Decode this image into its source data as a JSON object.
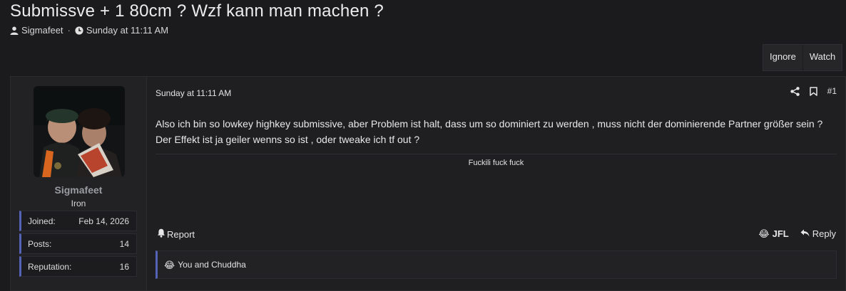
{
  "thread": {
    "title": "Submissve + 1 80cm ? Wzf kann man machen ?",
    "author": "Sigmafeet",
    "separator": "·",
    "date": "Sunday at 11:11 AM"
  },
  "header_buttons": {
    "ignore": "Ignore",
    "watch": "Watch"
  },
  "post": {
    "user": {
      "name": "Sigmafeet",
      "title": "Iron",
      "stats": [
        {
          "label": "Joined:",
          "value": "Feb 14, 2026"
        },
        {
          "label": "Posts:",
          "value": "14"
        },
        {
          "label": "Reputation:",
          "value": "16"
        }
      ]
    },
    "date": "Sunday at 11:11 AM",
    "number": "#1",
    "message": "Also ich bin so lowkey highkey submissive, aber Problem ist halt, dass um so dominiert zu werden , muss nicht der dominierende Partner größer sein ? Der Effekt ist ja geiler wenns so ist , oder tweake ich tf out ?",
    "signature": "Fuckili fuck fuck",
    "actions": {
      "report": "Report",
      "reaction": "JFL",
      "reply": "Reply"
    },
    "reactions_text": "You and Chuddha",
    "reaction_emoji": "😂"
  },
  "icons": [
    "user-icon",
    "clock-icon",
    "share-icon",
    "bookmark-icon",
    "bell-icon",
    "laugh-emoji-icon",
    "reply-icon"
  ],
  "colors": {
    "accent": "#5563b6",
    "username": "#9a9ca3",
    "background": "#1b1b1d"
  }
}
